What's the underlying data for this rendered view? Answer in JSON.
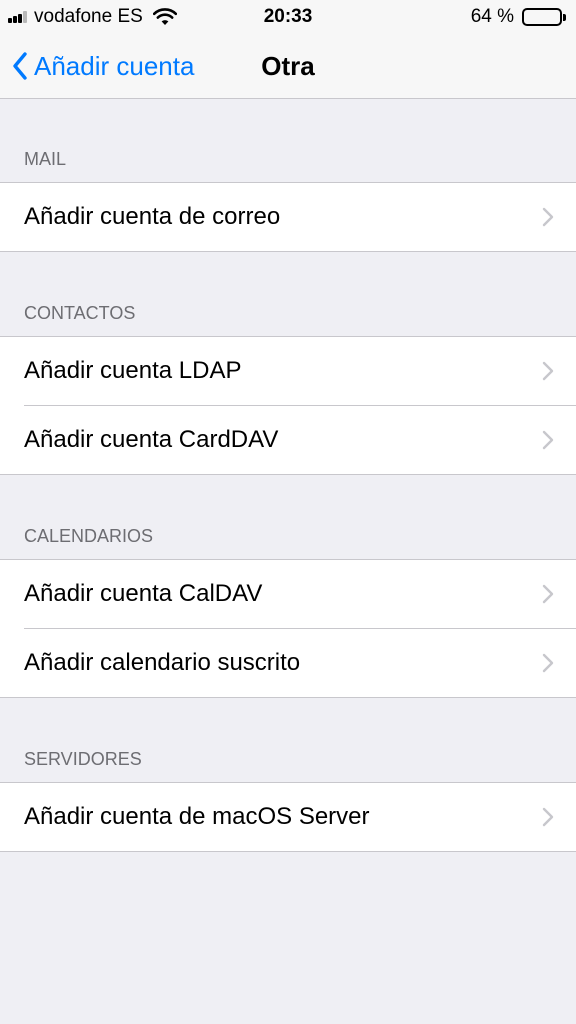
{
  "status_bar": {
    "carrier": "vodafone ES",
    "time": "20:33",
    "battery_percent_label": "64 %",
    "battery_level": 0.64,
    "signal_bars_active": 3,
    "signal_bars_total": 4
  },
  "nav": {
    "back_label": "Añadir cuenta",
    "title": "Otra",
    "accent_color": "#007aff"
  },
  "sections": [
    {
      "header": "MAIL",
      "items": [
        {
          "label": "Añadir cuenta de correo"
        }
      ]
    },
    {
      "header": "CONTACTOS",
      "items": [
        {
          "label": "Añadir cuenta LDAP"
        },
        {
          "label": "Añadir cuenta CardDAV"
        }
      ]
    },
    {
      "header": "CALENDARIOS",
      "items": [
        {
          "label": "Añadir cuenta CalDAV"
        },
        {
          "label": "Añadir calendario suscrito"
        }
      ]
    },
    {
      "header": "SERVIDORES",
      "items": [
        {
          "label": "Añadir cuenta de macOS Server"
        }
      ]
    }
  ]
}
